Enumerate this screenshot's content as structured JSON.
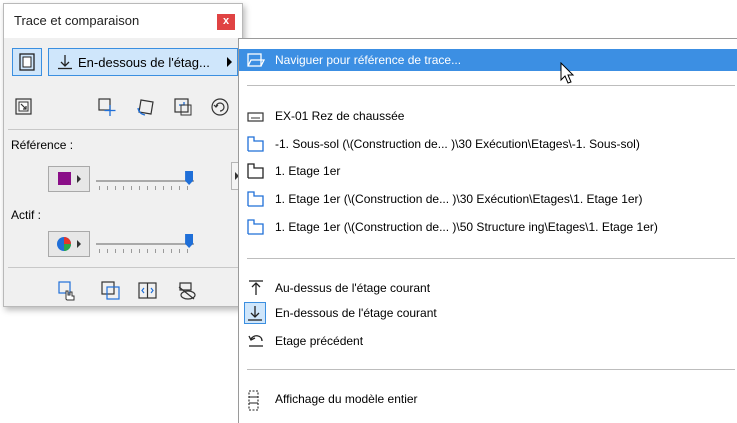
{
  "palette": {
    "title": "Trace et comparaison",
    "close_label": "x",
    "dropdown_label": "En-dessous de l'étag...",
    "reference_label": "Référence :",
    "reference_color": "#8a0e88",
    "reference_slider_value": 0.95,
    "active_label": "Actif :",
    "active_slider_value": 0.95,
    "accent_color": "#3c8fe3"
  },
  "menu": {
    "browse": "Naviguer pour référence de trace...",
    "stories": [
      "EX-01 Rez de chaussée",
      "-1. Sous-sol (\\(Construction de... )\\30 Exécution\\Etages\\-1. Sous-sol)",
      "1. Etage 1er",
      "1. Etage 1er (\\(Construction de... )\\30 Exécution\\Etages\\1. Etage 1er)",
      "1. Etage 1er (\\(Construction de... )\\50 Structure ing\\Etages\\1. Etage 1er)"
    ],
    "above": "Au-dessus de l'étage courant",
    "below": "En-dessous de l'étage courant",
    "previous": "Etage précédent",
    "full_model": "Affichage du modèle entier"
  }
}
